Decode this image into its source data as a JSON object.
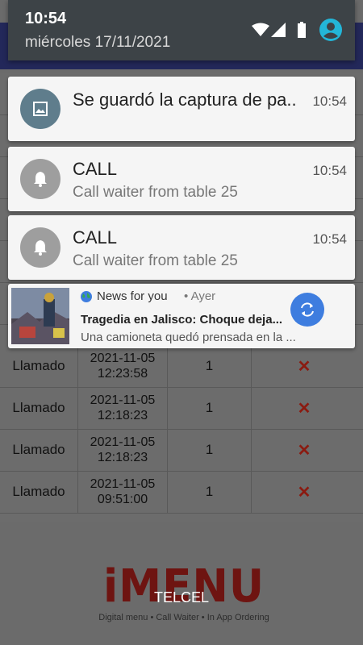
{
  "status_bar": {
    "time": "10:54",
    "date": "miércoles 17/11/2021"
  },
  "notifications": [
    {
      "title": "Se guardó la captura de pa..",
      "time": "10:54",
      "icon": "image-icon",
      "color": "#5f7d8c"
    },
    {
      "title": "CALL",
      "time": "10:54",
      "text": "Call waiter from table 25",
      "icon": "bell-icon",
      "color": "#9e9e9e"
    },
    {
      "title": "CALL",
      "time": "10:54",
      "text": "Call waiter from table 25",
      "icon": "bell-icon",
      "color": "#9e9e9e"
    }
  ],
  "news": {
    "app": "News for you",
    "when": "• Ayer",
    "title": "Tragedia en Jalisco: Choque deja...",
    "text": "Una camioneta quedó prensada en la ...",
    "refresh_color": "#3e7ddf"
  },
  "table": {
    "rows": [
      {
        "type": "Llamado",
        "date": "2021-11-05",
        "time": "12:23:58",
        "qty": "1"
      },
      {
        "type": "Llamado",
        "date": "2021-11-05",
        "time": "12:18:23",
        "qty": "1"
      },
      {
        "type": "Llamado",
        "date": "2021-11-05",
        "time": "12:18:23",
        "qty": "1"
      },
      {
        "type": "Llamado",
        "date": "2021-11-05",
        "time": "09:51:00",
        "qty": "1"
      }
    ],
    "delete_symbol": "✕"
  },
  "footer": {
    "logo": "iMENU",
    "tagline": "Digital menu • Call Waiter • In App Ordering",
    "carrier": "TELCEL"
  }
}
